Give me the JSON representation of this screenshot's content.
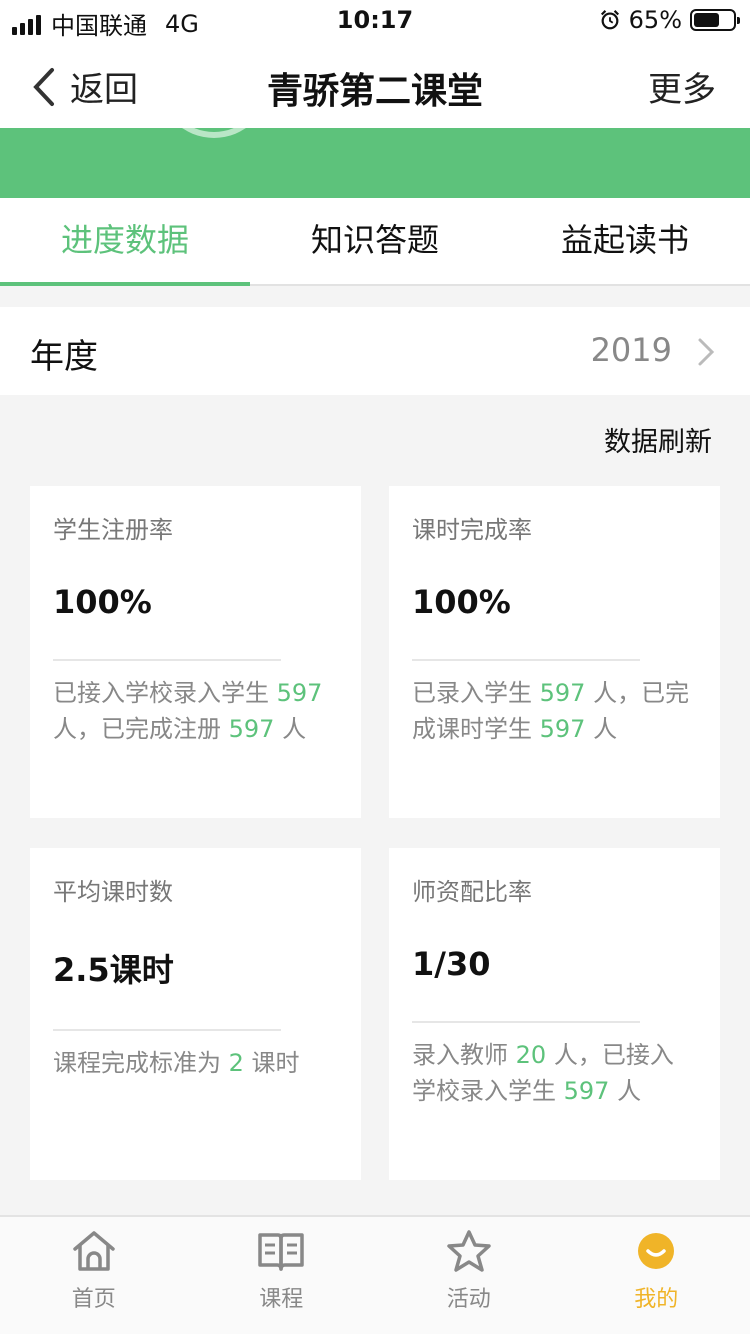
{
  "status_bar": {
    "carrier": "中国联通",
    "network": "4G",
    "time": "10:17",
    "battery": "65%",
    "battery_level": 0.65
  },
  "nav": {
    "back_label": "返回",
    "title": "青骄第二课堂",
    "more_label": "更多"
  },
  "banner": {
    "color": "#5dc27b"
  },
  "tabs": [
    {
      "label": "进度数据",
      "active": true
    },
    {
      "label": "知识答题",
      "active": false
    },
    {
      "label": "益起读书",
      "active": false
    }
  ],
  "year": {
    "label": "年度",
    "value": "2019"
  },
  "refresh_label": "数据刷新",
  "cards": [
    {
      "title": "学生注册率",
      "value": "100%",
      "desc": [
        {
          "t": "已接入学校录入学生 "
        },
        {
          "t": "597",
          "hl": true
        },
        {
          "t": " 人，已完成注册 "
        },
        {
          "t": "597",
          "hl": true
        },
        {
          "t": " 人"
        }
      ]
    },
    {
      "title": "课时完成率",
      "value": "100%",
      "desc": [
        {
          "t": "已录入学生 "
        },
        {
          "t": "597",
          "hl": true
        },
        {
          "t": " 人，已完成课时学生 "
        },
        {
          "t": "597",
          "hl": true
        },
        {
          "t": " 人"
        }
      ]
    },
    {
      "title": "平均课时数",
      "value": "2.5课时",
      "desc": [
        {
          "t": "课程完成标准为 "
        },
        {
          "t": "2",
          "hl": true
        },
        {
          "t": " 课时"
        }
      ]
    },
    {
      "title": "师资配比率",
      "value": "1/30",
      "desc": [
        {
          "t": "录入教师 "
        },
        {
          "t": "20",
          "hl": true
        },
        {
          "t": " 人，已接入学校录入学生 "
        },
        {
          "t": "597",
          "hl": true
        },
        {
          "t": " 人"
        }
      ]
    }
  ],
  "tabbar": [
    {
      "label": "首页",
      "icon": "home-icon",
      "active": false
    },
    {
      "label": "课程",
      "icon": "book-icon",
      "active": false
    },
    {
      "label": "活动",
      "icon": "star-icon",
      "active": false
    },
    {
      "label": "我的",
      "icon": "smile-icon",
      "active": true
    }
  ],
  "colors": {
    "accent": "#5dc27b",
    "tab_active": "#f0b428",
    "highlight": "#5dc27b"
  }
}
